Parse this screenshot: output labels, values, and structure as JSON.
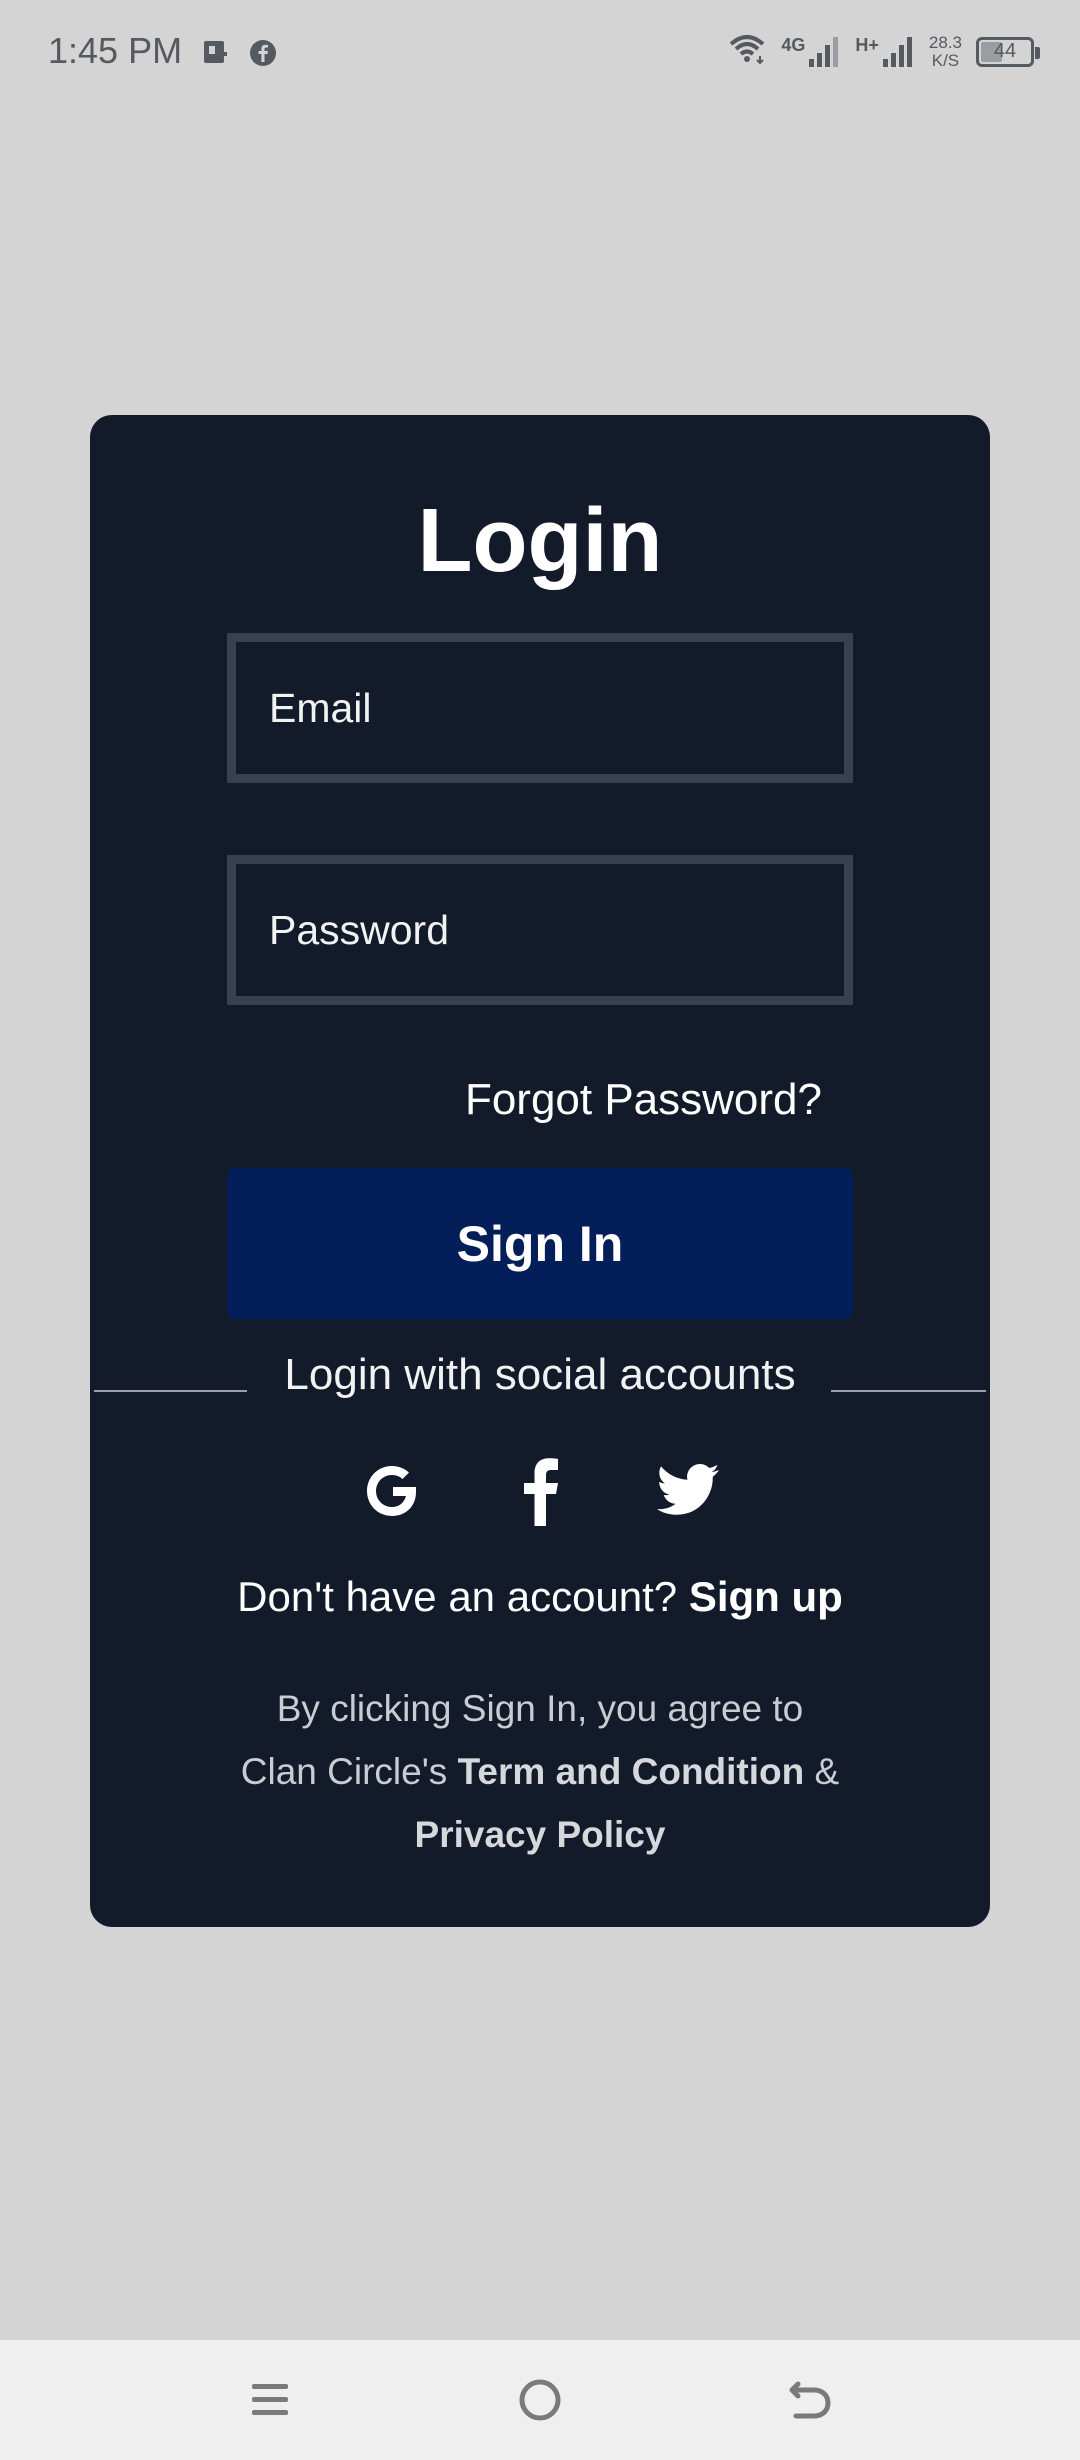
{
  "status_bar": {
    "time": "1:45 PM",
    "network_4g": "4G",
    "network_hplus": "H+",
    "speed_value": "28.3",
    "speed_unit": "K/S",
    "battery": "44",
    "battery_level_percent": 44
  },
  "login": {
    "title": "Login",
    "email_placeholder": "Email",
    "password_placeholder": "Password",
    "forgot_password": "Forgot Password?",
    "sign_in_button": "Sign In",
    "social_label": "Login with social accounts",
    "social_icons": [
      "google-icon",
      "facebook-icon",
      "twitter-icon"
    ],
    "signup_prompt": "Don't have an account?",
    "signup_link": "Sign up",
    "legal_line1": "By clicking Sign In, you agree to",
    "legal_prefix": "Clan Circle's",
    "legal_terms": "Term and Condition",
    "legal_amp": "&",
    "legal_privacy": "Privacy Policy"
  },
  "colors": {
    "background": "#d4d4d4",
    "card": "#131a29",
    "field_border": "#374151",
    "button": "#041e5a",
    "text": "#ffffff"
  },
  "nav_bar": {
    "icons": [
      "menu-icon",
      "home-icon",
      "back-icon"
    ]
  }
}
